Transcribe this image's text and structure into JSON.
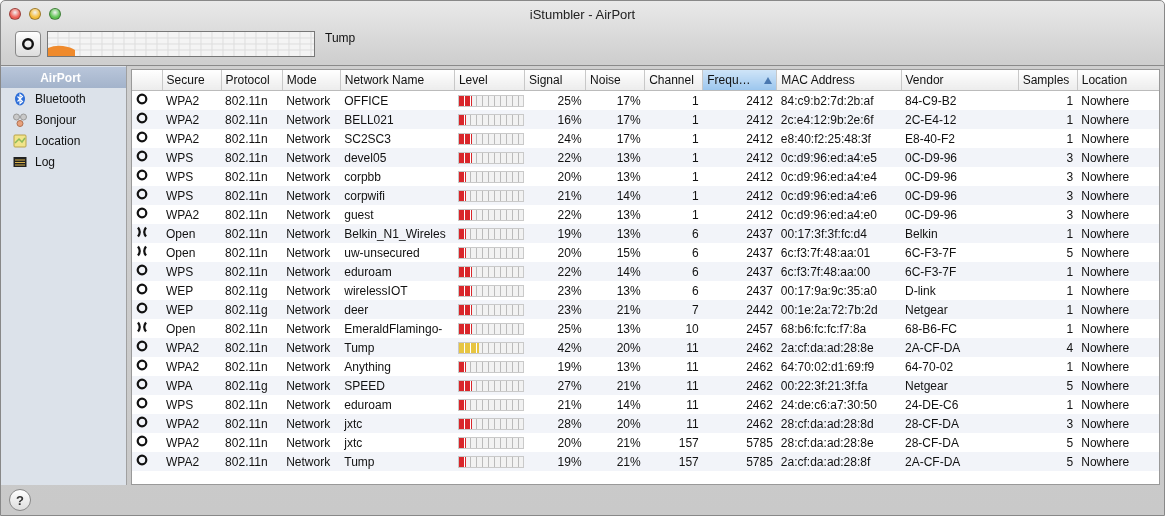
{
  "window": {
    "title": "iStumbler - AirPort"
  },
  "toolbar": {
    "current_network": "Tump"
  },
  "help_button": {
    "label": "?"
  },
  "sidebar": {
    "items": [
      {
        "label": "AirPort",
        "selected": true
      },
      {
        "label": "Bluetooth",
        "kind": "bluetooth",
        "selected": false
      },
      {
        "label": "Bonjour",
        "kind": "bonjour",
        "selected": false
      },
      {
        "label": "Location",
        "kind": "location",
        "selected": false
      },
      {
        "label": "Log",
        "kind": "log",
        "selected": false
      }
    ]
  },
  "table": {
    "columns": [
      {
        "selected": false
      },
      {
        "label": "Secure",
        "selected": false
      },
      {
        "label": "Protocol",
        "selected": false
      },
      {
        "label": "Mode",
        "selected": false
      },
      {
        "label": "Network Name",
        "selected": false
      },
      {
        "label": "Level",
        "selected": false
      },
      {
        "label": "Signal",
        "selected": false
      },
      {
        "label": "Noise",
        "selected": false
      },
      {
        "label": "Channel",
        "selected": false
      },
      {
        "label": "Frequ…",
        "selected": true
      },
      {
        "label": "MAC Address",
        "selected": false
      },
      {
        "label": "Vendor",
        "selected": false
      },
      {
        "label": "Samples",
        "selected": false
      },
      {
        "label": "Location",
        "selected": false
      }
    ],
    "rows": [
      {
        "kind": "secured",
        "secure": "WPA2",
        "protocol": "802.11n",
        "mode": "Network",
        "name": "OFFICE",
        "level": 0.2,
        "signal": "25%",
        "noise": "17%",
        "channel": "1",
        "frequency": "2412",
        "mac": "84:c9:b2:7d:2b:af",
        "vendor": "84-C9-B2",
        "samples": "1",
        "location": "Nowhere"
      },
      {
        "kind": "secured",
        "secure": "WPA2",
        "protocol": "802.11n",
        "mode": "Network",
        "name": "BELL021",
        "level": 0.1,
        "signal": "16%",
        "noise": "17%",
        "channel": "1",
        "frequency": "2412",
        "mac": "2c:e4:12:9b:2e:6f",
        "vendor": "2C-E4-12",
        "samples": "1",
        "location": "Nowhere"
      },
      {
        "kind": "secured",
        "secure": "WPA2",
        "protocol": "802.11n",
        "mode": "Network",
        "name": "SC2SC3",
        "level": 0.2,
        "signal": "24%",
        "noise": "17%",
        "channel": "1",
        "frequency": "2412",
        "mac": "e8:40:f2:25:48:3f",
        "vendor": "E8-40-F2",
        "samples": "1",
        "location": "Nowhere"
      },
      {
        "kind": "secured",
        "secure": "WPS",
        "protocol": "802.11n",
        "mode": "Network",
        "name": "devel05",
        "level": 0.2,
        "signal": "22%",
        "noise": "13%",
        "channel": "1",
        "frequency": "2412",
        "mac": "0c:d9:96:ed:a4:e5",
        "vendor": "0C-D9-96",
        "samples": "3",
        "location": "Nowhere"
      },
      {
        "kind": "secured",
        "secure": "WPS",
        "protocol": "802.11n",
        "mode": "Network",
        "name": "corpbb",
        "level": 0.1,
        "signal": "20%",
        "noise": "13%",
        "channel": "1",
        "frequency": "2412",
        "mac": "0c:d9:96:ed:a4:e4",
        "vendor": "0C-D9-96",
        "samples": "3",
        "location": "Nowhere"
      },
      {
        "kind": "secured",
        "secure": "WPS",
        "protocol": "802.11n",
        "mode": "Network",
        "name": "corpwifi",
        "level": 0.1,
        "signal": "21%",
        "noise": "14%",
        "channel": "1",
        "frequency": "2412",
        "mac": "0c:d9:96:ed:a4:e6",
        "vendor": "0C-D9-96",
        "samples": "3",
        "location": "Nowhere"
      },
      {
        "kind": "secured",
        "secure": "WPA2",
        "protocol": "802.11n",
        "mode": "Network",
        "name": "guest",
        "level": 0.2,
        "signal": "22%",
        "noise": "13%",
        "channel": "1",
        "frequency": "2412",
        "mac": "0c:d9:96:ed:a4:e0",
        "vendor": "0C-D9-96",
        "samples": "3",
        "location": "Nowhere"
      },
      {
        "kind": "open",
        "secure": "Open",
        "protocol": "802.11n",
        "mode": "Network",
        "name": "Belkin_N1_Wireles",
        "level": 0.1,
        "signal": "19%",
        "noise": "13%",
        "channel": "6",
        "frequency": "2437",
        "mac": "00:17:3f:3f:fc:d4",
        "vendor": "Belkin",
        "samples": "1",
        "location": "Nowhere"
      },
      {
        "kind": "open",
        "secure": "Open",
        "protocol": "802.11n",
        "mode": "Network",
        "name": "uw-unsecured",
        "level": 0.1,
        "signal": "20%",
        "noise": "15%",
        "channel": "6",
        "frequency": "2437",
        "mac": "6c:f3:7f:48:aa:01",
        "vendor": "6C-F3-7F",
        "samples": "5",
        "location": "Nowhere"
      },
      {
        "kind": "secured",
        "secure": "WPS",
        "protocol": "802.11n",
        "mode": "Network",
        "name": "eduroam",
        "level": 0.2,
        "signal": "22%",
        "noise": "14%",
        "channel": "6",
        "frequency": "2437",
        "mac": "6c:f3:7f:48:aa:00",
        "vendor": "6C-F3-7F",
        "samples": "1",
        "location": "Nowhere"
      },
      {
        "kind": "secured",
        "secure": "WEP",
        "protocol": "802.11g",
        "mode": "Network",
        "name": "wirelessIOT",
        "level": 0.2,
        "signal": "23%",
        "noise": "13%",
        "channel": "6",
        "frequency": "2437",
        "mac": "00:17:9a:9c:35:a0",
        "vendor": "D-link",
        "samples": "1",
        "location": "Nowhere"
      },
      {
        "kind": "secured",
        "secure": "WEP",
        "protocol": "802.11g",
        "mode": "Network",
        "name": "deer",
        "level": 0.2,
        "signal": "23%",
        "noise": "21%",
        "channel": "7",
        "frequency": "2442",
        "mac": "00:1e:2a:72:7b:2d",
        "vendor": "Netgear",
        "samples": "1",
        "location": "Nowhere"
      },
      {
        "kind": "open",
        "secure": "Open",
        "protocol": "802.11n",
        "mode": "Network",
        "name": "EmeraldFlamingo-",
        "level": 0.2,
        "signal": "25%",
        "noise": "13%",
        "channel": "10",
        "frequency": "2457",
        "mac": "68:b6:fc:fc:f7:8a",
        "vendor": "68-B6-FC",
        "samples": "1",
        "location": "Nowhere"
      },
      {
        "kind": "secured",
        "secure": "WPA2",
        "protocol": "802.11n",
        "mode": "Network",
        "name": "Tump",
        "level": 0.3,
        "signal": "42%",
        "noise": "20%",
        "channel": "11",
        "frequency": "2462",
        "mac": "2a:cf:da:ad:28:8e",
        "vendor": "2A-CF-DA",
        "samples": "4",
        "location": "Nowhere"
      },
      {
        "kind": "secured",
        "secure": "WPA2",
        "protocol": "802.11n",
        "mode": "Network",
        "name": "Anything",
        "level": 0.1,
        "signal": "19%",
        "noise": "13%",
        "channel": "11",
        "frequency": "2462",
        "mac": "64:70:02:d1:69:f9",
        "vendor": "64-70-02",
        "samples": "1",
        "location": "Nowhere"
      },
      {
        "kind": "secured",
        "secure": "WPA",
        "protocol": "802.11g",
        "mode": "Network",
        "name": "SPEED",
        "level": 0.2,
        "signal": "27%",
        "noise": "21%",
        "channel": "11",
        "frequency": "2462",
        "mac": "00:22:3f:21:3f:fa",
        "vendor": "Netgear",
        "samples": "5",
        "location": "Nowhere"
      },
      {
        "kind": "secured",
        "secure": "WPS",
        "protocol": "802.11n",
        "mode": "Network",
        "name": "eduroam",
        "level": 0.1,
        "signal": "21%",
        "noise": "14%",
        "channel": "11",
        "frequency": "2462",
        "mac": "24:de:c6:a7:30:50",
        "vendor": "24-DE-C6",
        "samples": "1",
        "location": "Nowhere"
      },
      {
        "kind": "secured",
        "secure": "WPA2",
        "protocol": "802.11n",
        "mode": "Network",
        "name": "jxtc",
        "level": 0.2,
        "signal": "28%",
        "noise": "20%",
        "channel": "11",
        "frequency": "2462",
        "mac": "28:cf:da:ad:28:8d",
        "vendor": "28-CF-DA",
        "samples": "3",
        "location": "Nowhere"
      },
      {
        "kind": "secured",
        "secure": "WPA2",
        "protocol": "802.11n",
        "mode": "Network",
        "name": "jxtc",
        "level": 0.1,
        "signal": "20%",
        "noise": "21%",
        "channel": "157",
        "frequency": "5785",
        "mac": "28:cf:da:ad:28:8e",
        "vendor": "28-CF-DA",
        "samples": "5",
        "location": "Nowhere"
      },
      {
        "kind": "secured",
        "secure": "WPA2",
        "protocol": "802.11n",
        "mode": "Network",
        "name": "Tump",
        "level": 0.1,
        "signal": "19%",
        "noise": "21%",
        "channel": "157",
        "frequency": "5785",
        "mac": "2a:cf:da:ad:28:8f",
        "vendor": "2A-CF-DA",
        "samples": "5",
        "location": "Nowhere"
      }
    ]
  }
}
